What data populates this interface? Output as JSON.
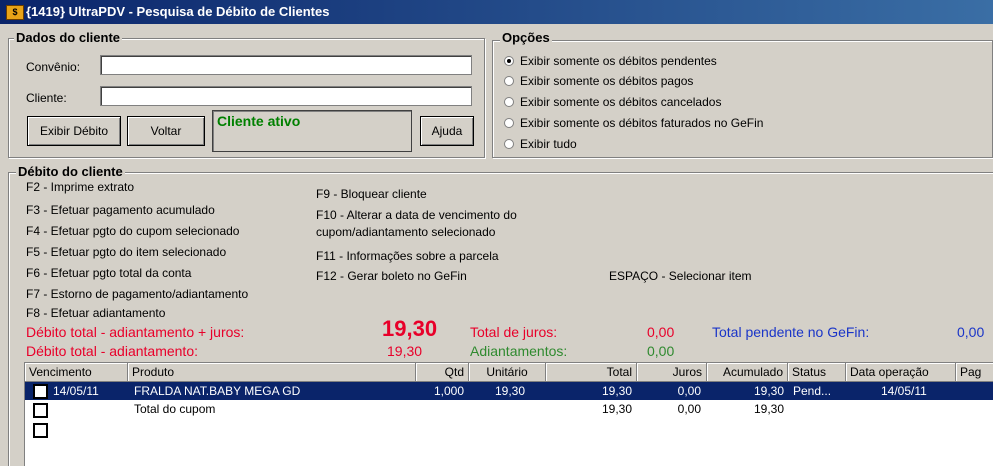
{
  "window": {
    "title": "{1419} UltraPDV - Pesquisa de Débito de Clientes",
    "icon": "app-icon"
  },
  "dados_cliente": {
    "legend": "Dados do cliente",
    "convenio_label": "Convênio:",
    "convenio_value": "",
    "cliente_label": "Cliente:",
    "cliente_value": "",
    "exibir_debito_button": "Exibir Débito",
    "voltar_button": "Voltar",
    "status_text": "Cliente ativo",
    "ajuda_button": "Ajuda"
  },
  "opcoes": {
    "legend": "Opções",
    "items": [
      {
        "label": "Exibir somente os débitos pendentes",
        "selected": true
      },
      {
        "label": "Exibir somente os débitos pagos",
        "selected": false
      },
      {
        "label": "Exibir somente os débitos cancelados",
        "selected": false
      },
      {
        "label": "Exibir somente os débitos faturados no GeFin",
        "selected": false
      },
      {
        "label": "Exibir tudo",
        "selected": false
      }
    ]
  },
  "debito": {
    "legend": "Débito do cliente",
    "shortcuts_left": [
      "F2 - Imprime extrato",
      "F3 - Efetuar pagamento acumulado",
      "F4 - Efetuar pgto do cupom selecionado",
      "F5 - Efetuar pgto do item selecionado",
      "F6 - Efetuar pgto total da conta",
      "F7 - Estorno de pagamento/adiantamento",
      "F8 - Efetuar adiantamento"
    ],
    "shortcuts_right": [
      "F9 - Bloquear cliente",
      "F10 - Alterar a data de vencimento do",
      "cupom/adiantamento selecionado",
      "F11 - Informações sobre a parcela",
      "F12 - Gerar boleto no GeFin"
    ],
    "shortcut_space": "ESPAÇO - Selecionar item",
    "totals": {
      "debito_juros_label": "Débito total - adiantamento + juros:",
      "debito_juros_value": "19,30",
      "debito_label": "Débito total - adiantamento:",
      "debito_value": "19,30",
      "juros_label": "Total de juros:",
      "juros_value": "0,00",
      "adiantamentos_label": "Adiantamentos:",
      "adiantamentos_value": "0,00",
      "gefin_label": "Total pendente no GeFin:",
      "gefin_value": "0,00"
    }
  },
  "table": {
    "columns": [
      "Vencimento",
      "Produto",
      "Qtd",
      "Unitário",
      "Total",
      "Juros",
      "Acumulado",
      "Status",
      "Data operação",
      "Pag"
    ],
    "rows": [
      {
        "vencimento": "14/05/11",
        "produto": "FRALDA NAT.BABY MEGA  GD",
        "qtd": "1,000",
        "unitario": "19,30",
        "total": "19,30",
        "juros": "0,00",
        "acumulado": "19,30",
        "status": "Pend...",
        "data": "14/05/11"
      },
      {
        "vencimento": "",
        "produto": "Total do cupom",
        "qtd": "",
        "unitario": "",
        "total": "19,30",
        "juros": "0,00",
        "acumulado": "19,30",
        "status": "",
        "data": ""
      }
    ]
  },
  "colors": {
    "titlebar": "#0a246a",
    "red": "#e8002a",
    "green": "#2f8a2f",
    "blue": "#1a35c8",
    "status_green": "#008000"
  }
}
